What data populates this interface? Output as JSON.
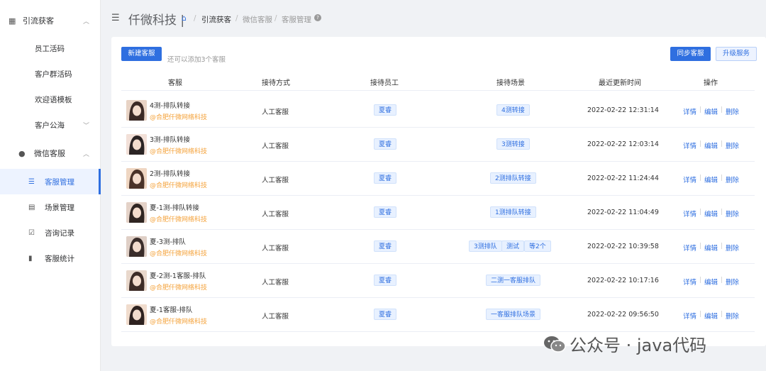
{
  "sidebar": {
    "group1": {
      "label": "引流获客",
      "icon": "qrcode-icon"
    },
    "group1_items": [
      {
        "label": "员工活码"
      },
      {
        "label": "客户群活码"
      },
      {
        "label": "欢迎语模板"
      },
      {
        "label": "客户公海"
      }
    ],
    "group2": {
      "label": "微信客服",
      "icon": "wechat-icon"
    },
    "group2_items": [
      {
        "label": "客服管理",
        "icon": "list-icon",
        "active": true
      },
      {
        "label": "场景管理",
        "icon": "scene-icon"
      },
      {
        "label": "咨询记录",
        "icon": "record-icon"
      },
      {
        "label": "客服统计",
        "icon": "bar-chart-icon"
      }
    ]
  },
  "header": {
    "brand": "仟微科技 |",
    "breadcrumb": [
      "引流获客",
      "微信客服",
      "客服管理"
    ]
  },
  "toolbar": {
    "new_label": "新建客服",
    "hint": "还可以添加3个客服",
    "sync_label": "同步客服",
    "upgrade_label": "升级服务"
  },
  "table": {
    "headers": [
      "客服",
      "接待方式",
      "接待员工",
      "接待场景",
      "最近更新时间",
      "操作"
    ],
    "rows": [
      {
        "name": "4测-排队转接",
        "corp": "@合肥仟微网络科技",
        "mode": "人工客服",
        "staff": "夏睿",
        "scenes": [
          "4测转接"
        ],
        "time": "2022-02-22 12:31:14"
      },
      {
        "name": "3测-排队转接",
        "corp": "@合肥仟微网络科技",
        "mode": "人工客服",
        "staff": "夏睿",
        "scenes": [
          "3测转接"
        ],
        "time": "2022-02-22 12:03:14"
      },
      {
        "name": "2测-排队转接",
        "corp": "@合肥仟微网络科技",
        "mode": "人工客服",
        "staff": "夏睿",
        "scenes": [
          "2测排队转接"
        ],
        "time": "2022-02-22 11:24:44"
      },
      {
        "name": "夏-1测-排队转接",
        "corp": "@合肥仟微网络科技",
        "mode": "人工客服",
        "staff": "夏睿",
        "scenes": [
          "1测排队转接"
        ],
        "time": "2022-02-22 11:04:49"
      },
      {
        "name": "夏-3测-排队",
        "corp": "@合肥仟微网络科技",
        "mode": "人工客服",
        "staff": "夏睿",
        "scenes": [
          "3测排队",
          "测试",
          "等2个"
        ],
        "time": "2022-02-22 10:39:58"
      },
      {
        "name": "夏-2测-1客服-排队",
        "corp": "@合肥仟微网络科技",
        "mode": "人工客服",
        "staff": "夏睿",
        "scenes": [
          "二测一客服排队"
        ],
        "time": "2022-02-22 10:17:16"
      },
      {
        "name": "夏-1客服-排队",
        "corp": "@合肥仟微网络科技",
        "mode": "人工客服",
        "staff": "夏睿",
        "scenes": [
          "一客服排队场景"
        ],
        "time": "2022-02-22 09:56:50"
      }
    ],
    "actions": [
      "详情",
      "编辑",
      "删除"
    ]
  },
  "watermark": {
    "text": "公众号 · java代码",
    "icon": "wechat-logo-icon"
  },
  "colors": {
    "primary": "#2f6fe0",
    "corp": "#f4a23a",
    "tag_bg": "#e8f1ff"
  }
}
